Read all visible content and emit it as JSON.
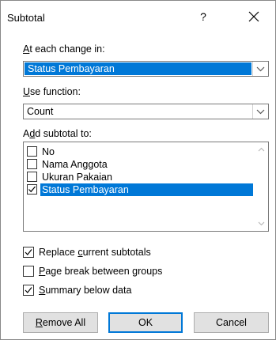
{
  "dialog": {
    "title": "Subtotal",
    "help_label": "?"
  },
  "change_in": {
    "label_first": "A",
    "label_rest": "t each change in:",
    "value": "Status Pembayaran"
  },
  "use_function": {
    "label_first": "U",
    "label_rest": "se function:",
    "value": "Count"
  },
  "add_subtotal": {
    "label_pre": "A",
    "label_underlined": "d",
    "label_rest": "d subtotal to:",
    "items": [
      {
        "label": "No",
        "checked": false,
        "selected": false
      },
      {
        "label": "Nama Anggota",
        "checked": false,
        "selected": false
      },
      {
        "label": "Ukuran Pakaian",
        "checked": false,
        "selected": false
      },
      {
        "label": "Status Pembayaran",
        "checked": true,
        "selected": true
      }
    ]
  },
  "options": {
    "replace_pre": "Replace ",
    "replace_underlined": "c",
    "replace_rest": "urrent subtotals",
    "replace_checked": true,
    "pagebreak_underlined": "P",
    "pagebreak_rest": "age break between groups",
    "pagebreak_checked": false,
    "summary_underlined": "S",
    "summary_rest": "ummary below data",
    "summary_checked": true
  },
  "buttons": {
    "remove_all_underlined": "R",
    "remove_all_rest": "emove All",
    "ok": "OK",
    "cancel": "Cancel"
  },
  "colors": {
    "accent": "#0078d7",
    "button_bg": "#e1e1e1"
  }
}
